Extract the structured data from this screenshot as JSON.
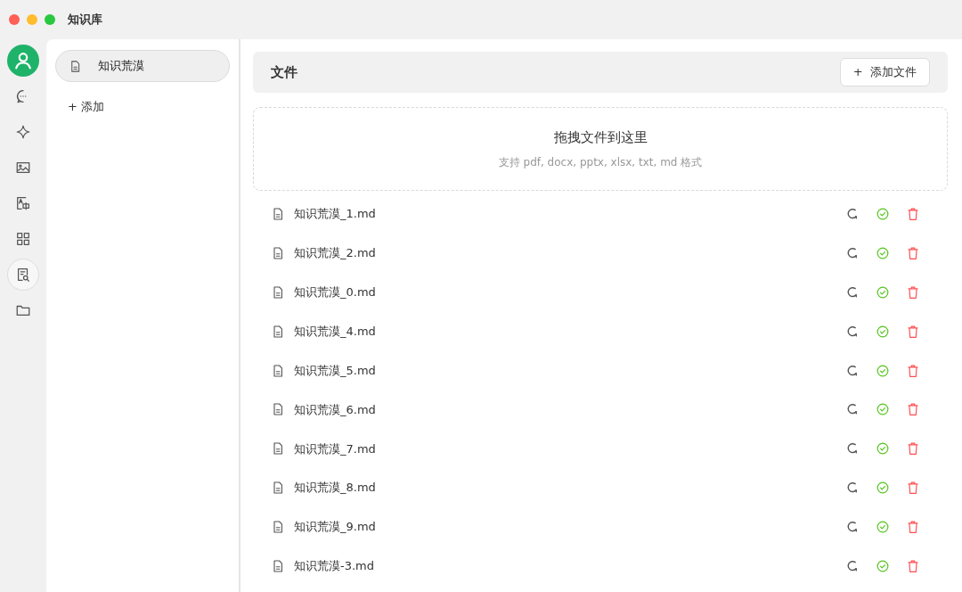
{
  "window": {
    "title": "知识库"
  },
  "nav": [
    {
      "kind": "avatar",
      "selected": false
    },
    {
      "kind": "chat",
      "selected": false
    },
    {
      "kind": "sparkle",
      "selected": false
    },
    {
      "kind": "image",
      "selected": false
    },
    {
      "kind": "translate",
      "selected": false
    },
    {
      "kind": "apps",
      "selected": false
    },
    {
      "kind": "knowledge",
      "selected": true
    },
    {
      "kind": "folder",
      "selected": false
    }
  ],
  "bases": [
    {
      "name": "知识荒漠",
      "selected": true
    }
  ],
  "add_base": {
    "icon": "+",
    "label": "添加"
  },
  "files_header": {
    "title": "文件",
    "add_button": {
      "icon": "+",
      "label": "添加文件"
    }
  },
  "dropzone": {
    "title": "拖拽文件到这里",
    "hint": "支持 pdf, docx, pptx, xlsx, txt, md 格式"
  },
  "files": [
    {
      "name": "知识荒漠_1.md"
    },
    {
      "name": "知识荒漠_2.md"
    },
    {
      "name": "知识荒漠_0.md"
    },
    {
      "name": "知识荒漠_4.md"
    },
    {
      "name": "知识荒漠_5.md"
    },
    {
      "name": "知识荒漠_6.md"
    },
    {
      "name": "知识荒漠_7.md"
    },
    {
      "name": "知识荒漠_8.md"
    },
    {
      "name": "知识荒漠_9.md"
    },
    {
      "name": "知识荒漠-3.md"
    }
  ]
}
